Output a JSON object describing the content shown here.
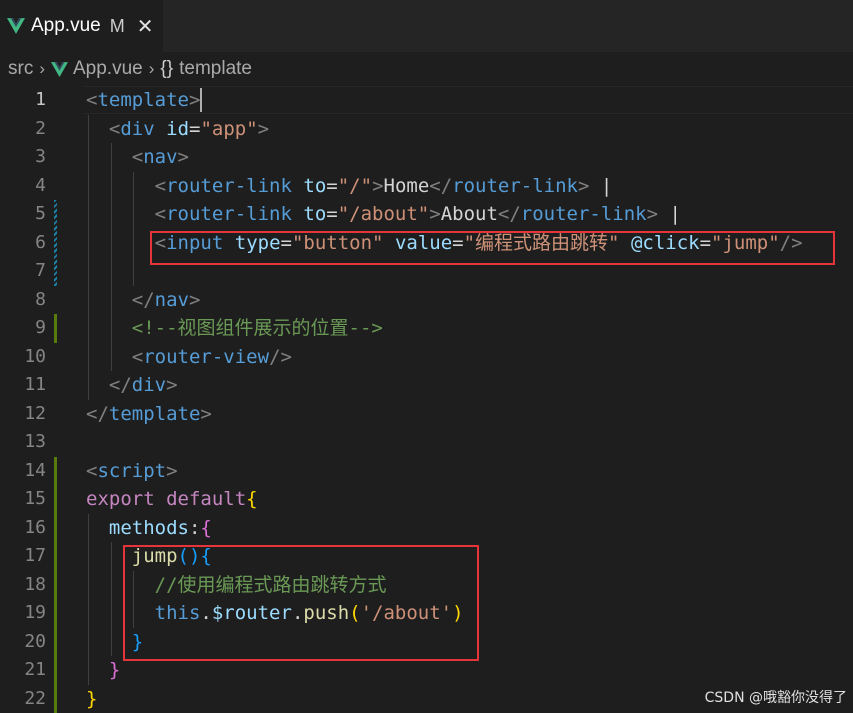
{
  "tab": {
    "filename": "App.vue",
    "modified_flag": "M",
    "close_glyph": "✕",
    "icon": "vue-icon"
  },
  "breadcrumb": {
    "items": [
      "src",
      "App.vue",
      "template"
    ],
    "separator": "›",
    "symbol_glyph": "{}"
  },
  "editor": {
    "active_line": 1,
    "line_numbers": [
      "1",
      "2",
      "3",
      "4",
      "5",
      "6",
      "7",
      "8",
      "9",
      "10",
      "11",
      "12",
      "13",
      "14",
      "15",
      "16",
      "17",
      "18",
      "19",
      "20",
      "21",
      "22"
    ],
    "lines": [
      [
        [
          "t-punc",
          "<"
        ],
        [
          "t-tag",
          "template"
        ],
        [
          "t-punc",
          ">"
        ]
      ],
      [
        [
          "t-text",
          "  "
        ],
        [
          "t-punc",
          "<"
        ],
        [
          "t-tag",
          "div"
        ],
        [
          "t-text",
          " "
        ],
        [
          "t-attr",
          "id"
        ],
        [
          "t-text",
          "="
        ],
        [
          "t-str",
          "\"app\""
        ],
        [
          "t-punc",
          ">"
        ]
      ],
      [
        [
          "t-text",
          "    "
        ],
        [
          "t-punc",
          "<"
        ],
        [
          "t-tag",
          "nav"
        ],
        [
          "t-punc",
          ">"
        ]
      ],
      [
        [
          "t-text",
          "      "
        ],
        [
          "t-punc",
          "<"
        ],
        [
          "t-tag",
          "router-link"
        ],
        [
          "t-text",
          " "
        ],
        [
          "t-attr",
          "to"
        ],
        [
          "t-text",
          "="
        ],
        [
          "t-str",
          "\"/\""
        ],
        [
          "t-punc",
          ">"
        ],
        [
          "t-text",
          "Home"
        ],
        [
          "t-punc",
          "</"
        ],
        [
          "t-tag",
          "router-link"
        ],
        [
          "t-punc",
          ">"
        ],
        [
          "t-text",
          " |"
        ]
      ],
      [
        [
          "t-text",
          "      "
        ],
        [
          "t-punc",
          "<"
        ],
        [
          "t-tag",
          "router-link"
        ],
        [
          "t-text",
          " "
        ],
        [
          "t-attr",
          "to"
        ],
        [
          "t-text",
          "="
        ],
        [
          "t-str",
          "\"/about\""
        ],
        [
          "t-punc",
          ">"
        ],
        [
          "t-text",
          "About"
        ],
        [
          "t-punc",
          "</"
        ],
        [
          "t-tag",
          "router-link"
        ],
        [
          "t-punc",
          ">"
        ],
        [
          "t-text",
          " |"
        ]
      ],
      [
        [
          "t-text",
          "      "
        ],
        [
          "t-punc",
          "<"
        ],
        [
          "t-tag",
          "input"
        ],
        [
          "t-text",
          " "
        ],
        [
          "t-attr",
          "type"
        ],
        [
          "t-text",
          "="
        ],
        [
          "t-str",
          "\"button\""
        ],
        [
          "t-text",
          " "
        ],
        [
          "t-attr",
          "value"
        ],
        [
          "t-text",
          "="
        ],
        [
          "t-str",
          "\"编程式路由跳转\""
        ],
        [
          "t-text",
          " "
        ],
        [
          "t-attr",
          "@click"
        ],
        [
          "t-text",
          "="
        ],
        [
          "t-str",
          "\"jump\""
        ],
        [
          "t-punc",
          "/>"
        ]
      ],
      [],
      [
        [
          "t-text",
          "    "
        ],
        [
          "t-punc",
          "</"
        ],
        [
          "t-tag",
          "nav"
        ],
        [
          "t-punc",
          ">"
        ]
      ],
      [
        [
          "t-text",
          "    "
        ],
        [
          "t-cmt",
          "<!--视图组件展示的位置-->"
        ]
      ],
      [
        [
          "t-text",
          "    "
        ],
        [
          "t-punc",
          "<"
        ],
        [
          "t-tag",
          "router-view"
        ],
        [
          "t-punc",
          "/>"
        ]
      ],
      [
        [
          "t-text",
          "  "
        ],
        [
          "t-punc",
          "</"
        ],
        [
          "t-tag",
          "div"
        ],
        [
          "t-punc",
          ">"
        ]
      ],
      [
        [
          "t-punc",
          "</"
        ],
        [
          "t-tag",
          "template"
        ],
        [
          "t-punc",
          ">"
        ]
      ],
      [],
      [
        [
          "t-punc",
          "<"
        ],
        [
          "t-tag",
          "script"
        ],
        [
          "t-punc",
          ">"
        ]
      ],
      [
        [
          "t-kw",
          "export"
        ],
        [
          "t-text",
          " "
        ],
        [
          "t-kw",
          "default"
        ],
        [
          "t-b1",
          "{"
        ]
      ],
      [
        [
          "t-text",
          "  "
        ],
        [
          "t-var",
          "methods"
        ],
        [
          "t-text",
          ":"
        ],
        [
          "t-b2",
          "{"
        ]
      ],
      [
        [
          "t-text",
          "    "
        ],
        [
          "t-fn",
          "jump"
        ],
        [
          "t-b3",
          "()"
        ],
        [
          "t-b3",
          "{"
        ]
      ],
      [
        [
          "t-text",
          "      "
        ],
        [
          "t-cmt",
          "//使用编程式路由跳转方式"
        ]
      ],
      [
        [
          "t-text",
          "      "
        ],
        [
          "t-kw2",
          "this"
        ],
        [
          "t-text",
          "."
        ],
        [
          "t-var",
          "$router"
        ],
        [
          "t-text",
          "."
        ],
        [
          "t-fn",
          "push"
        ],
        [
          "t-b1",
          "("
        ],
        [
          "t-str",
          "'/about'"
        ],
        [
          "t-b1",
          ")"
        ]
      ],
      [
        [
          "t-text",
          "    "
        ],
        [
          "t-b3",
          "}"
        ]
      ],
      [
        [
          "t-text",
          "  "
        ],
        [
          "t-b2",
          "}"
        ]
      ],
      [
        [
          "t-b1",
          "}"
        ]
      ]
    ]
  },
  "colors": {
    "highlight_box": "#e5343a",
    "vue_green": "#41b883",
    "vue_dark": "#35495e"
  },
  "watermark": "CSDN @哦豁你没得了"
}
